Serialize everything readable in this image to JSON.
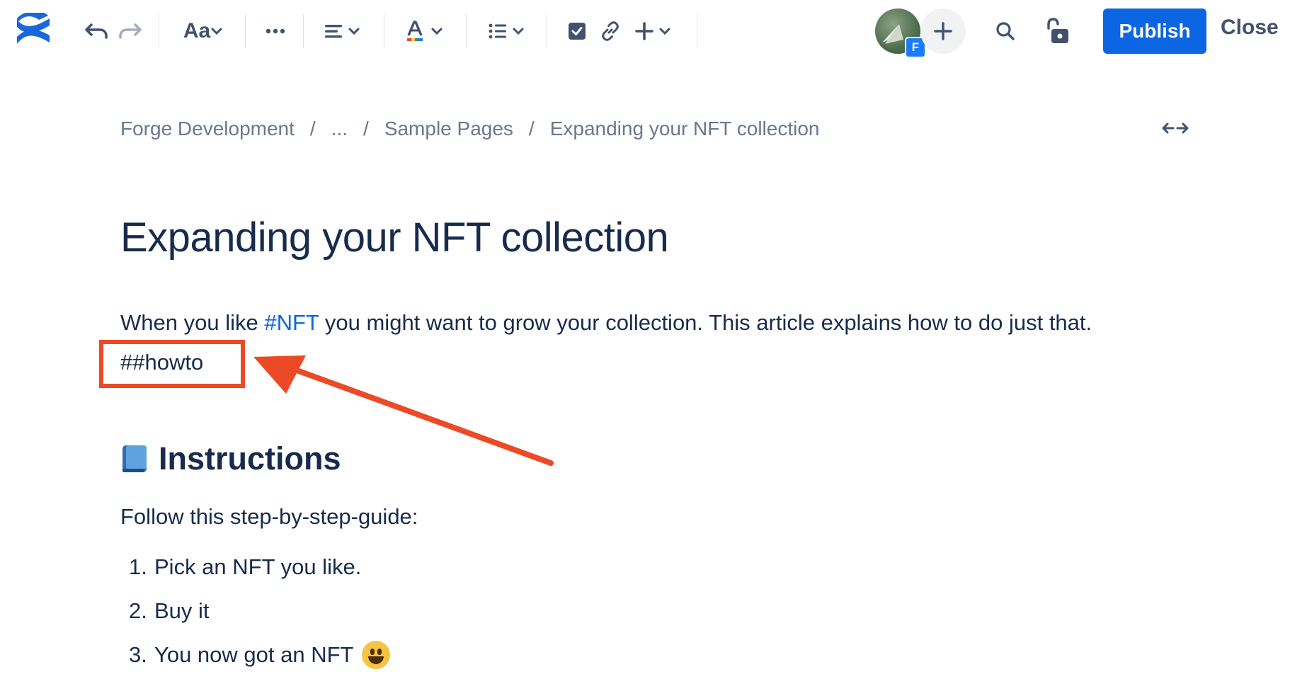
{
  "toolbar": {
    "text_style_label": "Aa",
    "more_label": "•••",
    "publish_label": "Publish",
    "close_label": "Close",
    "avatar_initial": "F"
  },
  "breadcrumb": {
    "items": [
      "Forge Development",
      "...",
      "Sample Pages",
      "Expanding your NFT collection"
    ],
    "separator": "/"
  },
  "page": {
    "title": "Expanding your NFT collection",
    "intro_before": "When you like ",
    "intro_hashtag": "#NFT",
    "intro_after": " you might want to grow your collection. This article explains how to do just that.",
    "howto": "##howto",
    "heading": "Instructions",
    "guide": "Follow this step-by-step-guide:",
    "steps": [
      {
        "num": "1.",
        "text": "Pick an NFT you like."
      },
      {
        "num": "2.",
        "text": "Buy it"
      },
      {
        "num": "3.",
        "text": "You now got an NFT"
      }
    ]
  },
  "colors": {
    "brand": "#1868db",
    "publish": "#0c66e4",
    "annotation": "#ec4a26",
    "hashtag": "#0c66e4"
  },
  "icons": [
    "confluence-logo-icon",
    "undo-icon",
    "redo-icon",
    "chevron-down-icon",
    "more-icon",
    "align-icon",
    "text-color-icon",
    "list-icon",
    "checkbox-icon",
    "link-icon",
    "plus-icon",
    "search-icon",
    "unlock-icon",
    "expand-width-icon",
    "book-icon",
    "grinning-face-icon"
  ]
}
